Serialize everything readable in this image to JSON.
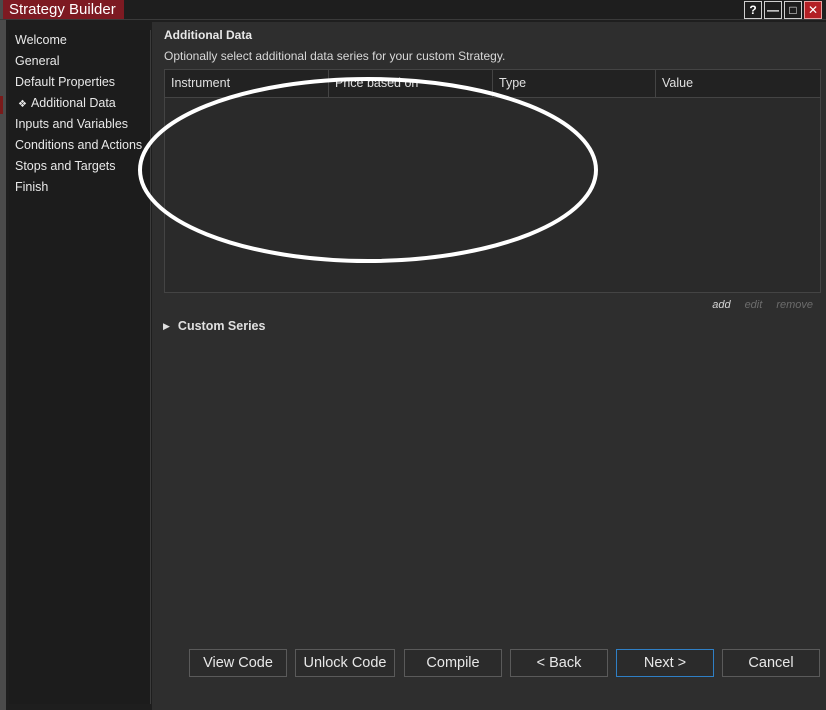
{
  "window": {
    "title": "Strategy Builder",
    "controls": {
      "help": "?",
      "minimize": "—",
      "maximize": "□",
      "close": "✕"
    }
  },
  "sidebar": {
    "items": [
      {
        "label": "Welcome",
        "active": false
      },
      {
        "label": "General",
        "active": false
      },
      {
        "label": "Default Properties",
        "active": false
      },
      {
        "label": "Additional Data",
        "active": true,
        "bullet": "❖"
      },
      {
        "label": "Inputs and Variables",
        "active": false
      },
      {
        "label": "Conditions and Actions",
        "active": false
      },
      {
        "label": "Stops and Targets",
        "active": false
      },
      {
        "label": "Finish",
        "active": false
      }
    ]
  },
  "main": {
    "title": "Additional Data",
    "description": "Optionally select additional data series for your custom Strategy.",
    "grid": {
      "columns": [
        "Instrument",
        "Price based on",
        "Type",
        "Value"
      ],
      "rows": []
    },
    "actions": {
      "add": "add",
      "edit": "edit",
      "remove": "remove"
    },
    "custom_series": {
      "label": "Custom Series",
      "expanded": false
    }
  },
  "footer": {
    "view_code": "View Code",
    "unlock_code": "Unlock Code",
    "compile": "Compile",
    "back": "< Back",
    "next": "Next >",
    "cancel": "Cancel"
  },
  "colors": {
    "title_accent": "#7d1a22",
    "primary_button_border": "#2f7fc5",
    "annotation_ellipse": "#ffffff"
  }
}
